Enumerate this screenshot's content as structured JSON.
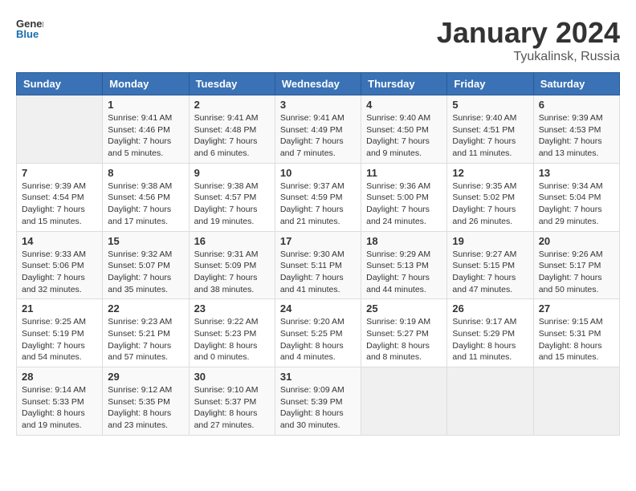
{
  "header": {
    "logo_general": "General",
    "logo_blue": "Blue",
    "month_title": "January 2024",
    "location": "Tyukalinsk, Russia"
  },
  "days_of_week": [
    "Sunday",
    "Monday",
    "Tuesday",
    "Wednesday",
    "Thursday",
    "Friday",
    "Saturday"
  ],
  "weeks": [
    [
      {
        "day": "",
        "info": ""
      },
      {
        "day": "1",
        "info": "Sunrise: 9:41 AM\nSunset: 4:46 PM\nDaylight: 7 hours\nand 5 minutes."
      },
      {
        "day": "2",
        "info": "Sunrise: 9:41 AM\nSunset: 4:48 PM\nDaylight: 7 hours\nand 6 minutes."
      },
      {
        "day": "3",
        "info": "Sunrise: 9:41 AM\nSunset: 4:49 PM\nDaylight: 7 hours\nand 7 minutes."
      },
      {
        "day": "4",
        "info": "Sunrise: 9:40 AM\nSunset: 4:50 PM\nDaylight: 7 hours\nand 9 minutes."
      },
      {
        "day": "5",
        "info": "Sunrise: 9:40 AM\nSunset: 4:51 PM\nDaylight: 7 hours\nand 11 minutes."
      },
      {
        "day": "6",
        "info": "Sunrise: 9:39 AM\nSunset: 4:53 PM\nDaylight: 7 hours\nand 13 minutes."
      }
    ],
    [
      {
        "day": "7",
        "info": "Sunrise: 9:39 AM\nSunset: 4:54 PM\nDaylight: 7 hours\nand 15 minutes."
      },
      {
        "day": "8",
        "info": "Sunrise: 9:38 AM\nSunset: 4:56 PM\nDaylight: 7 hours\nand 17 minutes."
      },
      {
        "day": "9",
        "info": "Sunrise: 9:38 AM\nSunset: 4:57 PM\nDaylight: 7 hours\nand 19 minutes."
      },
      {
        "day": "10",
        "info": "Sunrise: 9:37 AM\nSunset: 4:59 PM\nDaylight: 7 hours\nand 21 minutes."
      },
      {
        "day": "11",
        "info": "Sunrise: 9:36 AM\nSunset: 5:00 PM\nDaylight: 7 hours\nand 24 minutes."
      },
      {
        "day": "12",
        "info": "Sunrise: 9:35 AM\nSunset: 5:02 PM\nDaylight: 7 hours\nand 26 minutes."
      },
      {
        "day": "13",
        "info": "Sunrise: 9:34 AM\nSunset: 5:04 PM\nDaylight: 7 hours\nand 29 minutes."
      }
    ],
    [
      {
        "day": "14",
        "info": "Sunrise: 9:33 AM\nSunset: 5:06 PM\nDaylight: 7 hours\nand 32 minutes."
      },
      {
        "day": "15",
        "info": "Sunrise: 9:32 AM\nSunset: 5:07 PM\nDaylight: 7 hours\nand 35 minutes."
      },
      {
        "day": "16",
        "info": "Sunrise: 9:31 AM\nSunset: 5:09 PM\nDaylight: 7 hours\nand 38 minutes."
      },
      {
        "day": "17",
        "info": "Sunrise: 9:30 AM\nSunset: 5:11 PM\nDaylight: 7 hours\nand 41 minutes."
      },
      {
        "day": "18",
        "info": "Sunrise: 9:29 AM\nSunset: 5:13 PM\nDaylight: 7 hours\nand 44 minutes."
      },
      {
        "day": "19",
        "info": "Sunrise: 9:27 AM\nSunset: 5:15 PM\nDaylight: 7 hours\nand 47 minutes."
      },
      {
        "day": "20",
        "info": "Sunrise: 9:26 AM\nSunset: 5:17 PM\nDaylight: 7 hours\nand 50 minutes."
      }
    ],
    [
      {
        "day": "21",
        "info": "Sunrise: 9:25 AM\nSunset: 5:19 PM\nDaylight: 7 hours\nand 54 minutes."
      },
      {
        "day": "22",
        "info": "Sunrise: 9:23 AM\nSunset: 5:21 PM\nDaylight: 7 hours\nand 57 minutes."
      },
      {
        "day": "23",
        "info": "Sunrise: 9:22 AM\nSunset: 5:23 PM\nDaylight: 8 hours\nand 0 minutes."
      },
      {
        "day": "24",
        "info": "Sunrise: 9:20 AM\nSunset: 5:25 PM\nDaylight: 8 hours\nand 4 minutes."
      },
      {
        "day": "25",
        "info": "Sunrise: 9:19 AM\nSunset: 5:27 PM\nDaylight: 8 hours\nand 8 minutes."
      },
      {
        "day": "26",
        "info": "Sunrise: 9:17 AM\nSunset: 5:29 PM\nDaylight: 8 hours\nand 11 minutes."
      },
      {
        "day": "27",
        "info": "Sunrise: 9:15 AM\nSunset: 5:31 PM\nDaylight: 8 hours\nand 15 minutes."
      }
    ],
    [
      {
        "day": "28",
        "info": "Sunrise: 9:14 AM\nSunset: 5:33 PM\nDaylight: 8 hours\nand 19 minutes."
      },
      {
        "day": "29",
        "info": "Sunrise: 9:12 AM\nSunset: 5:35 PM\nDaylight: 8 hours\nand 23 minutes."
      },
      {
        "day": "30",
        "info": "Sunrise: 9:10 AM\nSunset: 5:37 PM\nDaylight: 8 hours\nand 27 minutes."
      },
      {
        "day": "31",
        "info": "Sunrise: 9:09 AM\nSunset: 5:39 PM\nDaylight: 8 hours\nand 30 minutes."
      },
      {
        "day": "",
        "info": ""
      },
      {
        "day": "",
        "info": ""
      },
      {
        "day": "",
        "info": ""
      }
    ]
  ]
}
